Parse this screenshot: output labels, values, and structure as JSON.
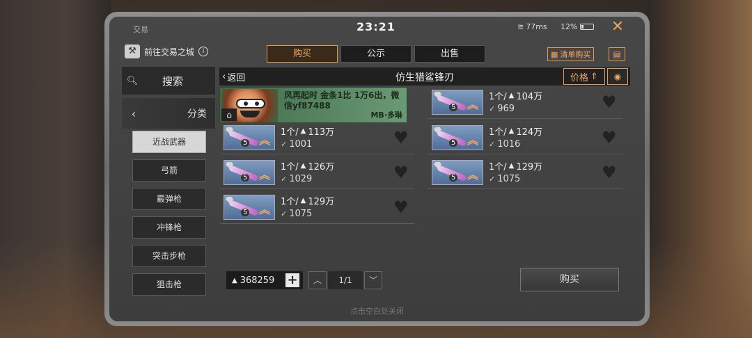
{
  "status": {
    "app_name": "交易",
    "time": "23:21",
    "network": "77ms",
    "battery": "12%",
    "close_icon": "close-icon"
  },
  "topnav": {
    "goto_city": "前往交易之城",
    "tabs": [
      {
        "label": "购买",
        "active": true
      },
      {
        "label": "公示",
        "active": false
      },
      {
        "label": "出售",
        "active": false
      }
    ],
    "bulk_buy": "清单购买"
  },
  "sidebar": {
    "search": "搜索",
    "category": "分类",
    "items": [
      {
        "label": "近战武器",
        "selected": true
      },
      {
        "label": "弓箭",
        "selected": false
      },
      {
        "label": "霰弹枪",
        "selected": false
      },
      {
        "label": "冲锋枪",
        "selected": false
      },
      {
        "label": "突击步枪",
        "selected": false
      },
      {
        "label": "狙击枪",
        "selected": false
      }
    ]
  },
  "header": {
    "back": "返回",
    "title": "仿生猎鲨锋刃",
    "sort": "价格"
  },
  "ad": {
    "text": "风再起时 金条1比 1万6出，微信yf87488",
    "user": "MB·多琳"
  },
  "listings": [
    {
      "qty": "1个/",
      "price": "113万",
      "stock": "1001",
      "level": "5"
    },
    {
      "qty": "1个/",
      "price": "126万",
      "stock": "1029",
      "level": "5"
    },
    {
      "qty": "1个/",
      "price": "129万",
      "stock": "1075",
      "level": "5"
    },
    {
      "qty": "1个/",
      "price": "104万",
      "stock": "969",
      "level": "5"
    },
    {
      "qty": "1个/",
      "price": "124万",
      "stock": "1016",
      "level": "5"
    },
    {
      "qty": "1个/",
      "price": "129万",
      "stock": "1075",
      "level": "5"
    }
  ],
  "footer": {
    "wallet": "368259",
    "page": "1/1",
    "buy": "购买",
    "close_hint": "点击空白处关闭"
  },
  "colors": {
    "accent": "#e39a55",
    "panel": "#424242"
  }
}
